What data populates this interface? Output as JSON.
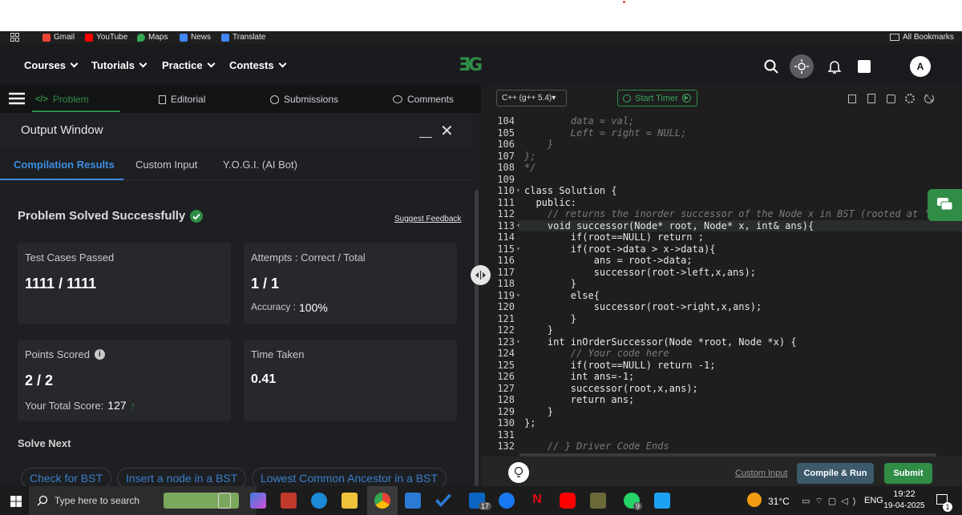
{
  "bookmarks": {
    "items": [
      {
        "label": "Gmail",
        "icon": "gmail-icon",
        "color": "#ea4335"
      },
      {
        "label": "YouTube",
        "icon": "youtube-icon",
        "color": "#ff0000"
      },
      {
        "label": "Maps",
        "icon": "maps-icon",
        "color": "#34a853"
      },
      {
        "label": "News",
        "icon": "news-icon",
        "color": "#4285f4"
      },
      {
        "label": "Translate",
        "icon": "translate-icon",
        "color": "#4285f4"
      }
    ],
    "all_bookmarks": "All Bookmarks"
  },
  "nav": {
    "items": [
      "Courses",
      "Tutorials",
      "Practice",
      "Contests"
    ],
    "logo": "ƎG",
    "avatar": "A",
    "brand_color": "#2f8d46"
  },
  "problem_tabs": {
    "problem": "Problem",
    "editorial": "Editorial",
    "submissions": "Submissions",
    "comments": "Comments"
  },
  "output": {
    "title": "Output Window",
    "minimize": "_",
    "close": "✕",
    "tabs": [
      "Compilation Results",
      "Custom Input",
      "Y.O.G.I. (AI Bot)"
    ],
    "status": "Problem Solved Successfully",
    "suggest": "Suggest Feedback",
    "test_label": "Test Cases Passed",
    "test_value": "1111 / 1111",
    "attempts_label": "Attempts : Correct / Total",
    "attempts_value": "1 / 1",
    "accuracy_label": "Accuracy :",
    "accuracy_value": "100%",
    "points_label": "Points Scored",
    "points_value": "2 / 2",
    "total_label": "Your Total Score:",
    "total_value": "127",
    "time_label": "Time Taken",
    "time_value": "0.41",
    "solve_next": "Solve Next",
    "next_items": [
      "Check for BST",
      "Insert a node in a BST",
      "Lowest Common Ancestor in a BST"
    ]
  },
  "editor": {
    "language": "C++ (g++ 5.4)",
    "timer": "Start Timer",
    "lines": [
      {
        "n": "104",
        "t": "        data = val;",
        "c": true
      },
      {
        "n": "105",
        "t": "        Left = right = NULL;",
        "c": true
      },
      {
        "n": "106",
        "t": "    }",
        "c": true
      },
      {
        "n": "107",
        "t": "};",
        "c": true
      },
      {
        "n": "108",
        "t": "*/",
        "c": true
      },
      {
        "n": "109",
        "t": "",
        "c": false
      },
      {
        "n": "110",
        "t": "class Solution {",
        "c": false
      },
      {
        "n": "111",
        "t": "  public:",
        "c": false
      },
      {
        "n": "112",
        "t": "    // returns the inorder successor of the Node x in BST (rooted at 'r",
        "c": true
      },
      {
        "n": "113",
        "t": "    void successor(Node* root, Node* x, int& ans){",
        "c": false
      },
      {
        "n": "114",
        "t": "        if(root==NULL) return ;",
        "c": false
      },
      {
        "n": "115",
        "t": "        if(root->data > x->data){",
        "c": false
      },
      {
        "n": "116",
        "t": "            ans = root->data;",
        "c": false
      },
      {
        "n": "117",
        "t": "            successor(root->left,x,ans);",
        "c": false
      },
      {
        "n": "118",
        "t": "        }",
        "c": false
      },
      {
        "n": "119",
        "t": "        else{",
        "c": false
      },
      {
        "n": "120",
        "t": "            successor(root->right,x,ans);",
        "c": false
      },
      {
        "n": "121",
        "t": "        }",
        "c": false
      },
      {
        "n": "122",
        "t": "    }",
        "c": false
      },
      {
        "n": "123",
        "t": "    int inOrderSuccessor(Node *root, Node *x) {",
        "c": false
      },
      {
        "n": "124",
        "t": "        // Your code here",
        "c": true
      },
      {
        "n": "125",
        "t": "        if(root==NULL) return -1;",
        "c": false
      },
      {
        "n": "126",
        "t": "        int ans=-1;",
        "c": false
      },
      {
        "n": "127",
        "t": "        successor(root,x,ans);",
        "c": false
      },
      {
        "n": "128",
        "t": "        return ans;",
        "c": false
      },
      {
        "n": "129",
        "t": "    }",
        "c": false
      },
      {
        "n": "130",
        "t": "};",
        "c": false
      },
      {
        "n": "131",
        "t": "",
        "c": false
      },
      {
        "n": "132",
        "t": "    // } Driver Code Ends",
        "c": true
      }
    ],
    "custom_input": "Custom Input",
    "compile_run": "Compile & Run",
    "submit": "Submit"
  },
  "taskbar": {
    "search_placeholder": "Type here to search",
    "temperature": "31°C",
    "lang": "ENG",
    "time": "19:22",
    "date": "19-04-2025",
    "badge_linkedin": "17",
    "badge_whatsapp": "9",
    "badge_notif": "1"
  }
}
